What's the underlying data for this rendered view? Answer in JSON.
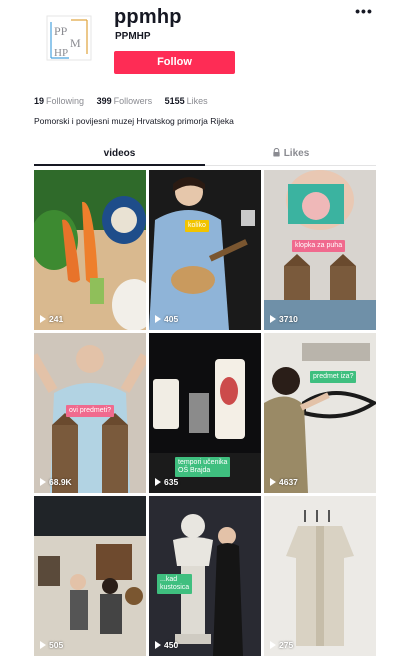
{
  "profile": {
    "username": "ppmhp",
    "nickname": "PPMHP",
    "follow_label": "Follow",
    "more_label": "•••",
    "bio": "Pomorski i povijesni muzej Hrvatskog primorja Rijeka",
    "logo_icon": "ppmhp-logo"
  },
  "stats": {
    "following_count": "19",
    "following_label": "Following",
    "followers_count": "399",
    "followers_label": "Followers",
    "likes_count": "5155",
    "likes_label": "Likes"
  },
  "tabs": {
    "videos": "videos",
    "likes": "Likes",
    "likes_icon": "lock-icon"
  },
  "colors": {
    "accent": "#fe2c55",
    "text": "#161823",
    "muted": "#8a8b91"
  },
  "videos": [
    {
      "views": "241",
      "caption": ""
    },
    {
      "views": "405",
      "caption": "koliko"
    },
    {
      "views": "3710",
      "caption": "klopka za puha"
    },
    {
      "views": "68.9K",
      "caption": "ovi predmeti?"
    },
    {
      "views": "635",
      "caption": "tempori učenika",
      "caption2": "OŠ Brajda"
    },
    {
      "views": "4637",
      "caption": "predmet iza?"
    },
    {
      "views": "505",
      "caption": ""
    },
    {
      "views": "450",
      "caption": "...kad",
      "caption2": "kustosica"
    },
    {
      "views": "275",
      "caption": ""
    }
  ]
}
